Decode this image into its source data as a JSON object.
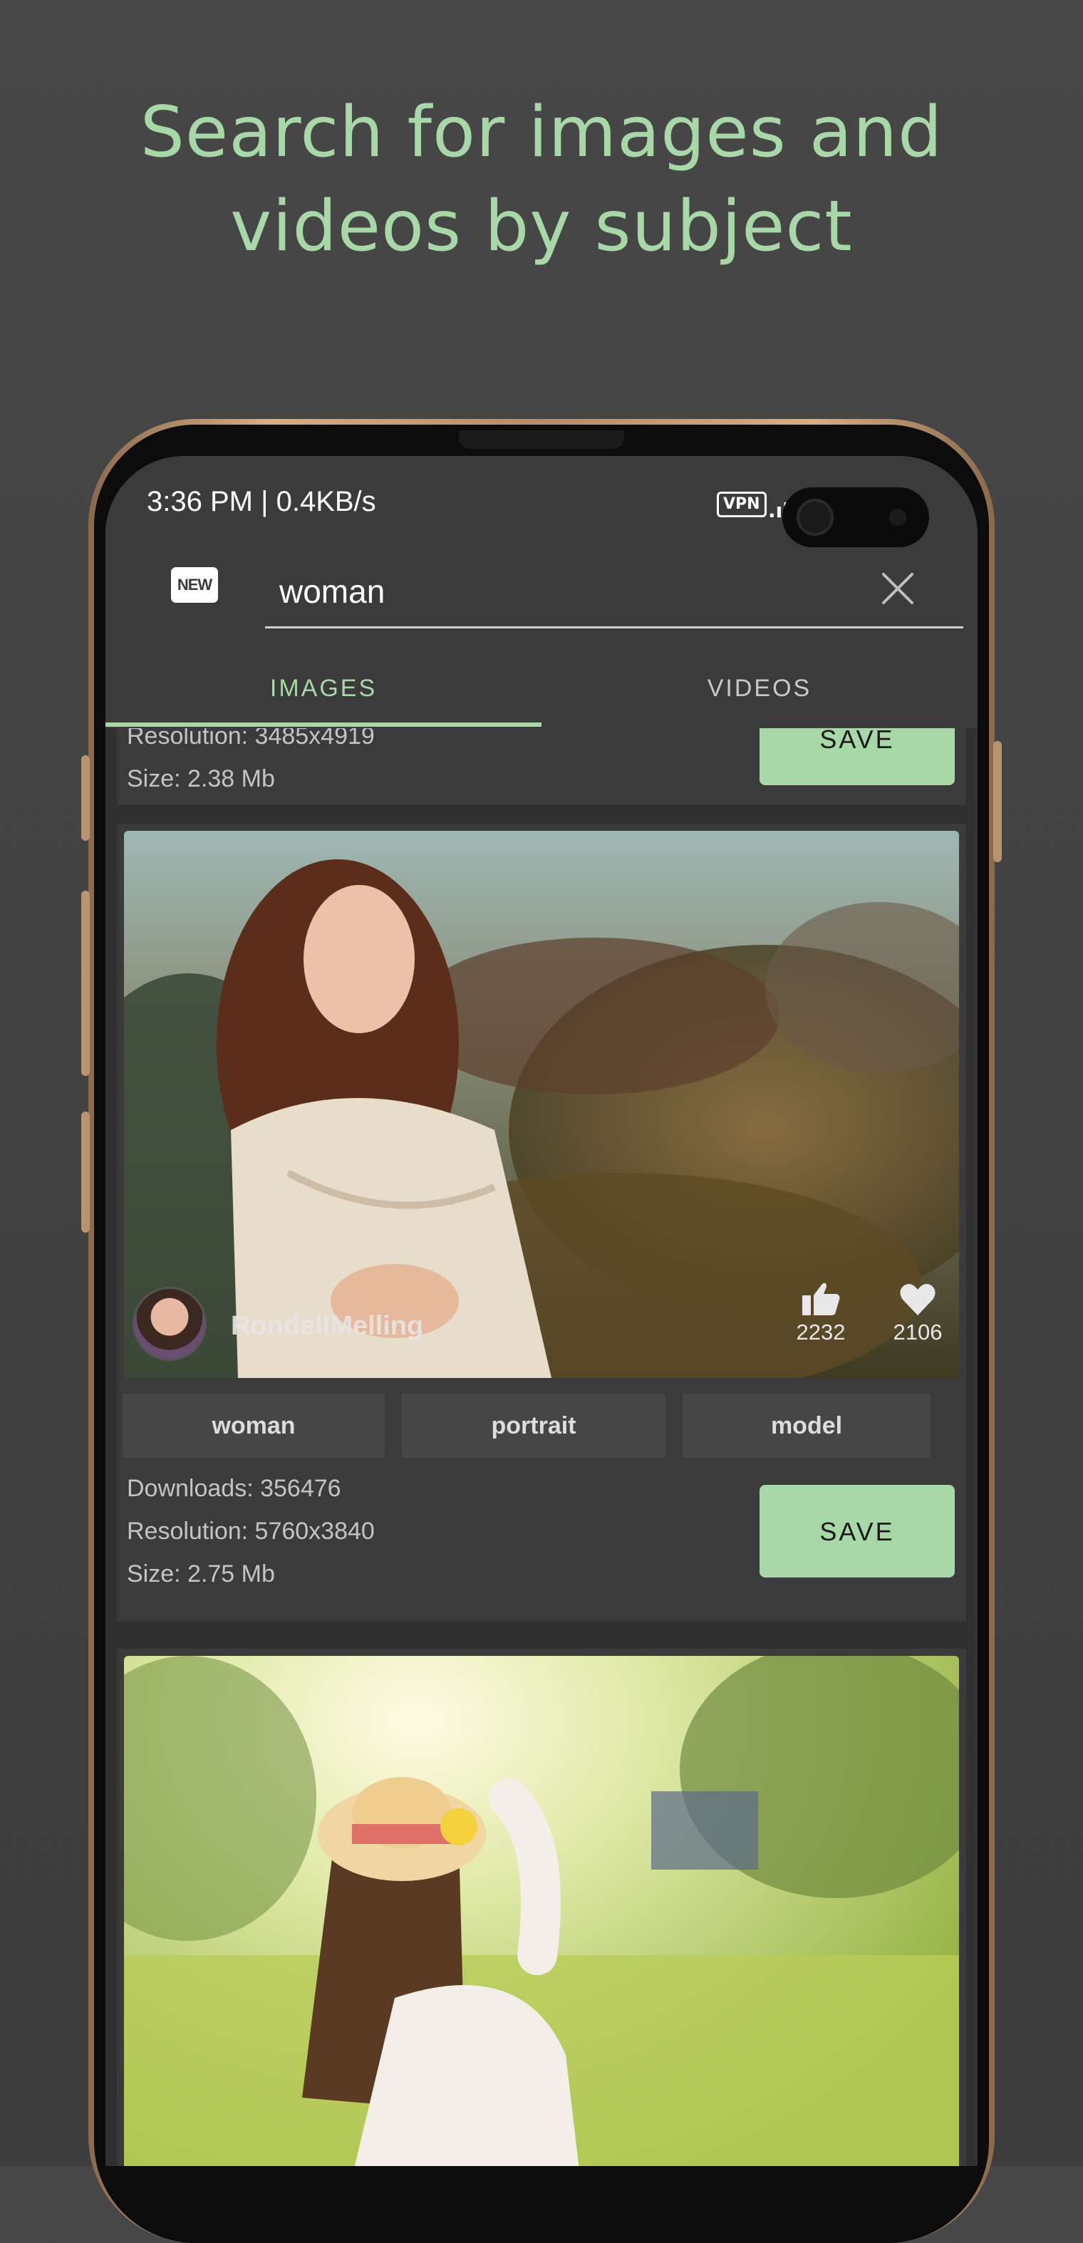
{
  "headline": {
    "line1": "Search for images and",
    "line2": "videos by subject"
  },
  "status_bar": {
    "time_speed": "3:36 PM | 0.4KB/s",
    "vpn": "VPN"
  },
  "search": {
    "badge": "NEW",
    "query": "woman"
  },
  "tabs": [
    {
      "label": "IMAGES",
      "active": true
    },
    {
      "label": "VIDEOS",
      "active": false
    }
  ],
  "colors": {
    "accent": "#a8d8a8",
    "background": "#303030",
    "card": "#3b3b3b"
  },
  "cards": [
    {
      "resolution": "Resolution: 3485x4919",
      "size": "Size: 2.38 Mb",
      "save_label": "SAVE"
    },
    {
      "author": "RondellMelling",
      "likes": "2232",
      "favorites": "2106",
      "tags": [
        "woman",
        "portrait",
        "model"
      ],
      "downloads": "Downloads: 356476",
      "resolution": "Resolution: 5760x3840",
      "size": "Size: 2.75 Mb",
      "save_label": "SAVE"
    }
  ],
  "icons": {
    "close": "close-icon",
    "like": "thumbs-up-icon",
    "favorite": "heart-icon"
  }
}
